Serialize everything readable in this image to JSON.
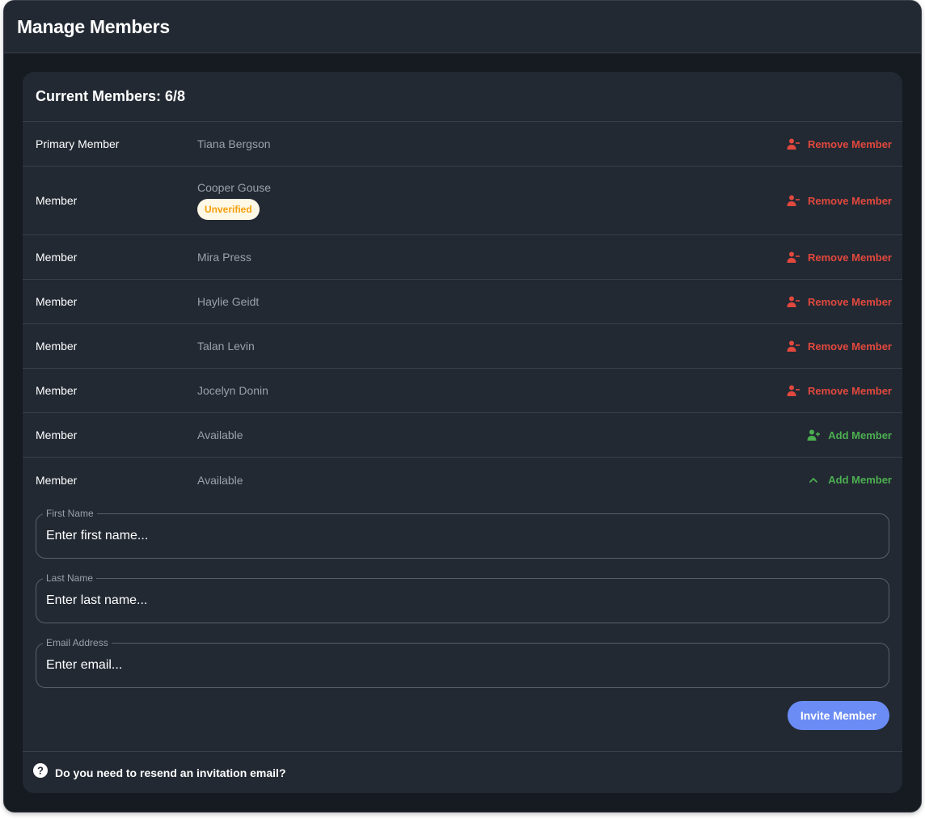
{
  "window": {
    "title": "Manage Members"
  },
  "card": {
    "title": "Current Members: 6/8"
  },
  "members": [
    {
      "role": "Primary Member",
      "name": "Tiana Bergson",
      "badge": null,
      "action": "Remove Member",
      "action_type": "remove",
      "action_icon": "user-minus-icon"
    },
    {
      "role": "Member",
      "name": "Cooper Gouse",
      "badge": "Unverified",
      "action": "Remove Member",
      "action_type": "remove",
      "action_icon": "user-minus-icon"
    },
    {
      "role": "Member",
      "name": "Mira Press",
      "badge": null,
      "action": "Remove Member",
      "action_type": "remove",
      "action_icon": "user-minus-icon"
    },
    {
      "role": "Member",
      "name": "Haylie Geidt",
      "badge": null,
      "action": "Remove Member",
      "action_type": "remove",
      "action_icon": "user-minus-icon"
    },
    {
      "role": "Member",
      "name": "Talan Levin",
      "badge": null,
      "action": "Remove Member",
      "action_type": "remove",
      "action_icon": "user-minus-icon"
    },
    {
      "role": "Member",
      "name": "Jocelyn Donin",
      "badge": null,
      "action": "Remove Member",
      "action_type": "remove",
      "action_icon": "user-minus-icon"
    },
    {
      "role": "Member",
      "name": "Available",
      "badge": null,
      "action": "Add Member",
      "action_type": "add",
      "action_icon": "user-plus-icon"
    },
    {
      "role": "Member",
      "name": "Available",
      "badge": null,
      "action": "Add Member",
      "action_type": "add",
      "action_icon": "chevron-up-icon"
    }
  ],
  "form": {
    "first_name": {
      "label": "First Name",
      "placeholder": "Enter first name..."
    },
    "last_name": {
      "label": "Last Name",
      "placeholder": "Enter last name..."
    },
    "email": {
      "label": "Email Address",
      "placeholder": "Enter email..."
    },
    "submit_label": "Invite Member"
  },
  "footer": {
    "help_text": "Do you need to resend an invitation email?",
    "icon": "help-circle-icon"
  },
  "colors": {
    "remove": "#e2483d",
    "add": "#4caf50",
    "primary_button": "#6b8cf4",
    "badge_text": "#f59e0b",
    "badge_bg": "#fff8e6"
  }
}
